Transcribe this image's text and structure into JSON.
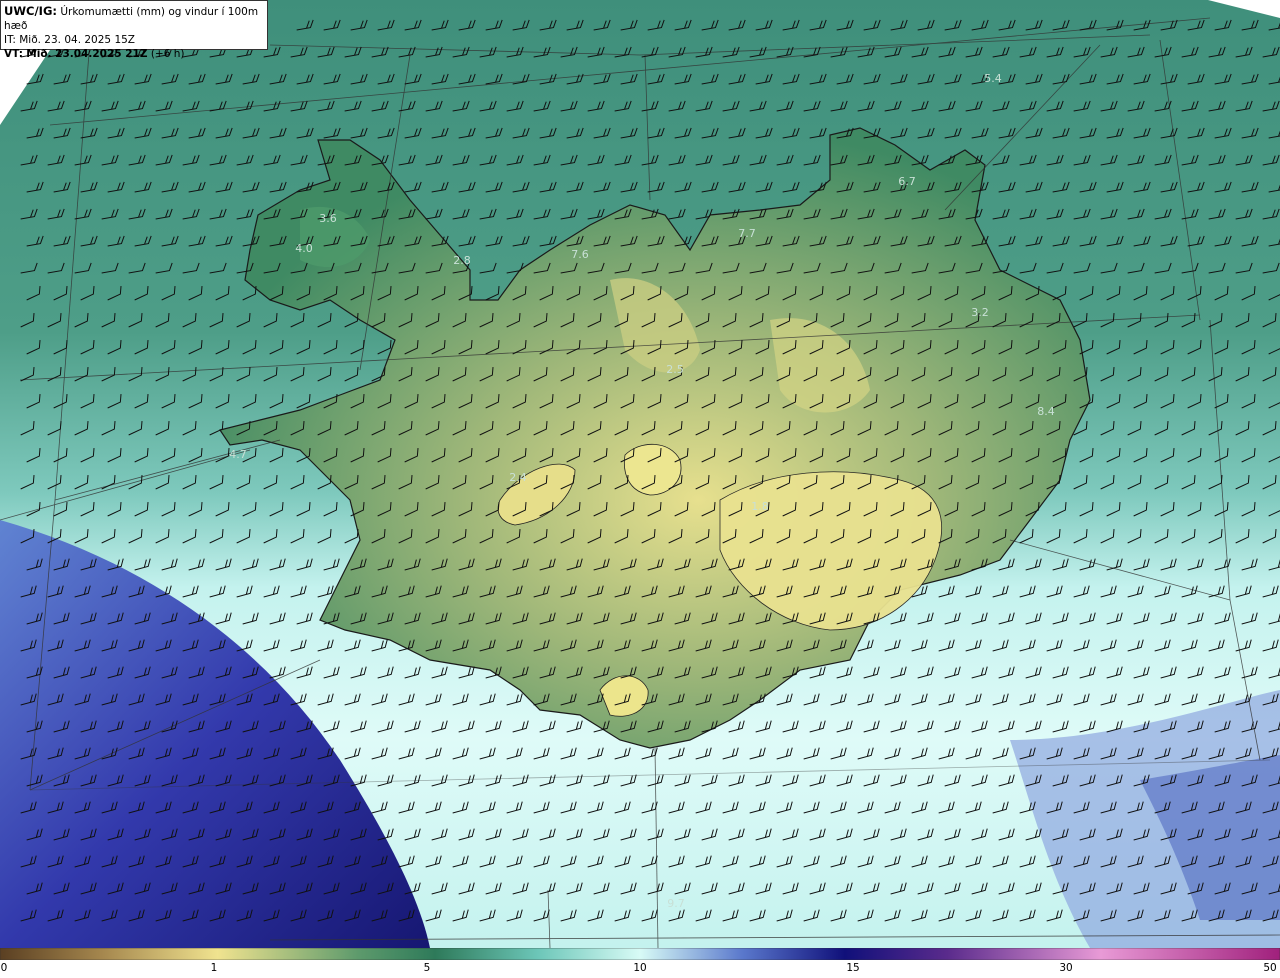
{
  "header": {
    "model": "UWC/IG:",
    "title": "Úrkomumætti (mm) og vindur í 100m hæð",
    "init_time": "IT: Mið. 23. 04. 2025 15Z",
    "valid_prefix": "VT:",
    "valid_time": "Mið. 23.04.2025 21Z",
    "lead": "(+6 h)"
  },
  "map_values": [
    {
      "text": "5.4"
    },
    {
      "text": "6.7"
    },
    {
      "text": "7.7"
    },
    {
      "text": "7.6"
    },
    {
      "text": "3.6"
    },
    {
      "text": "4.0"
    },
    {
      "text": "2.8"
    },
    {
      "text": "3.2"
    },
    {
      "text": "2.5"
    },
    {
      "text": "8.4"
    },
    {
      "text": "4.7"
    },
    {
      "text": "2.4"
    },
    {
      "text": "1.8"
    },
    {
      "text": "9.7"
    }
  ],
  "colorbar": {
    "ticks": [
      "0",
      "1",
      "5",
      "10",
      "15",
      "30",
      "50"
    ],
    "colors": [
      "#6b4e2a",
      "#a88c52",
      "#e8dc88",
      "#2e7a5a",
      "#7ed6cc",
      "#d6fff8",
      "#3e5fb8",
      "#12127a",
      "#6a2a8a",
      "#e07acc",
      "#b42a8a"
    ]
  },
  "colors": {
    "land_low": "#e3de8a",
    "land_mid": "#5f9b6b",
    "land_dark": "#2e7a5a",
    "sea": "#4a9e86",
    "cyan_band": "#c8f4f0",
    "deep_blue": "#1c2a9a"
  },
  "wind_glyph": "wind-barb-icon"
}
